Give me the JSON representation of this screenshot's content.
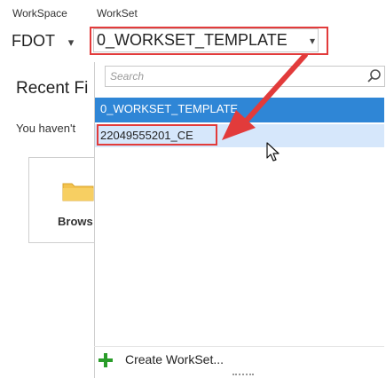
{
  "workspace": {
    "label": "WorkSpace",
    "value": "FDOT",
    "chevron": "▾"
  },
  "workset": {
    "label": "WorkSet",
    "value": "0_WORKSET_TEMPLATE",
    "chevron": "▾"
  },
  "left_panel": {
    "recent_title": "Recent Fi",
    "empty_text": "You haven't",
    "browse_label": "Brows"
  },
  "dropdown": {
    "search_placeholder": "Search",
    "items": [
      {
        "label": "0_WORKSET_TEMPLATE",
        "state": "selected"
      },
      {
        "label": "22049555201_CE",
        "state": "hover"
      }
    ],
    "create_label": "Create WorkSet..."
  },
  "colors": {
    "accent": "#2f86d6",
    "hover": "#d6e7fb",
    "annotation": "#e23b3b",
    "plus": "#2a9c2a",
    "folder": "#f3c24d"
  },
  "icons": {
    "search": "search-icon",
    "plus": "plus-icon",
    "folder": "folder-icon",
    "cursor": "mouse-cursor-icon",
    "arrow": "annotation-arrow"
  }
}
